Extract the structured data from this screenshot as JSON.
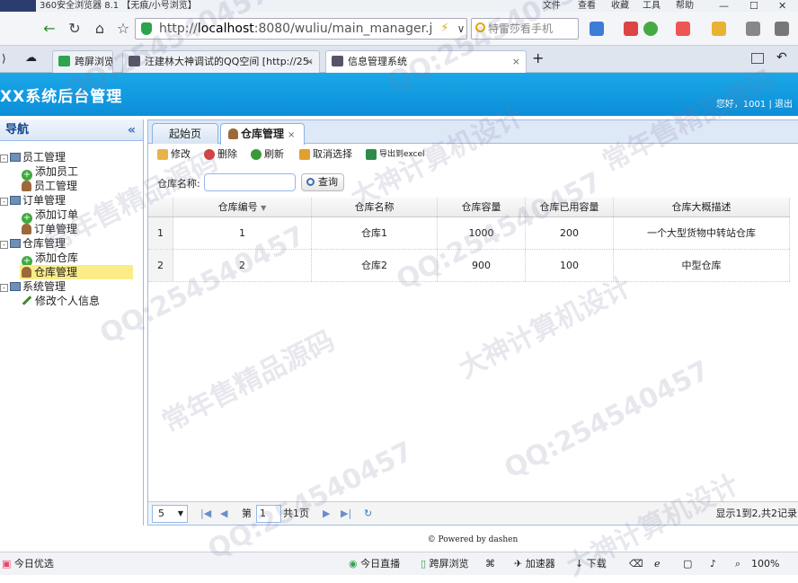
{
  "browser": {
    "title": "360安全浏览器 8.1 【无痕/小号浏览】",
    "menu": [
      "文件",
      "查看",
      "收藏",
      "工具",
      "帮助"
    ],
    "url_prefix": "http://",
    "url_host": "localhost",
    "url_rest": ":8080/wuliu/main_manager.j",
    "search_placeholder": "特雷莎看手机",
    "tabs": [
      {
        "label": "跨屏浏览"
      },
      {
        "label": "汪建林大神调试的QQ空间 [http://25-",
        "close": "×"
      },
      {
        "label": "信息管理系统",
        "close": "×"
      }
    ],
    "new_tab": "+"
  },
  "app": {
    "title": "XX系统后台管理",
    "greeting": "您好，1001",
    "logout": "退出"
  },
  "nav": {
    "title": "导航",
    "collapse": "«",
    "groups": [
      {
        "label": "员工管理",
        "items": [
          "添加员工",
          "员工管理"
        ]
      },
      {
        "label": "订单管理",
        "items": [
          "添加订单",
          "订单管理"
        ]
      },
      {
        "label": "仓库管理",
        "items": [
          "添加仓库",
          "仓库管理"
        ]
      },
      {
        "label": "系统管理",
        "items": [
          "修改个人信息"
        ]
      }
    ]
  },
  "content": {
    "tabs": [
      {
        "label": "起始页"
      },
      {
        "label": "仓库管理",
        "close": "×"
      }
    ],
    "toolbar": {
      "edit": "修改",
      "delete": "删除",
      "refresh": "刷新",
      "cancel": "取消选择",
      "export": "导出到excel"
    },
    "filter": {
      "label": "仓库名称:",
      "button": "查询"
    },
    "grid": {
      "columns": [
        "仓库编号",
        "仓库名称",
        "仓库容量",
        "仓库已用容量",
        "仓库大概描述"
      ],
      "rows": [
        {
          "n": "1",
          "cells": [
            "1",
            "仓库1",
            "1000",
            "200",
            "一个大型货物中转站仓库"
          ]
        },
        {
          "n": "2",
          "cells": [
            "2",
            "仓库2",
            "900",
            "100",
            "中型仓库"
          ]
        }
      ]
    },
    "pager": {
      "page_size": "5",
      "page_label": "第",
      "page_value": "1",
      "page_total": "共1页",
      "info": "显示1到2,共2记录"
    },
    "footer": "© Powered by dashen"
  },
  "status": {
    "left": "今日优选",
    "live": "今日直播",
    "cross": "跨屏浏览",
    "accel": "加速器",
    "download": "下载",
    "zoom": "100%"
  },
  "watermarks": [
    "QQ:254540457",
    "常年售精品源码",
    "大神计算机设计"
  ]
}
